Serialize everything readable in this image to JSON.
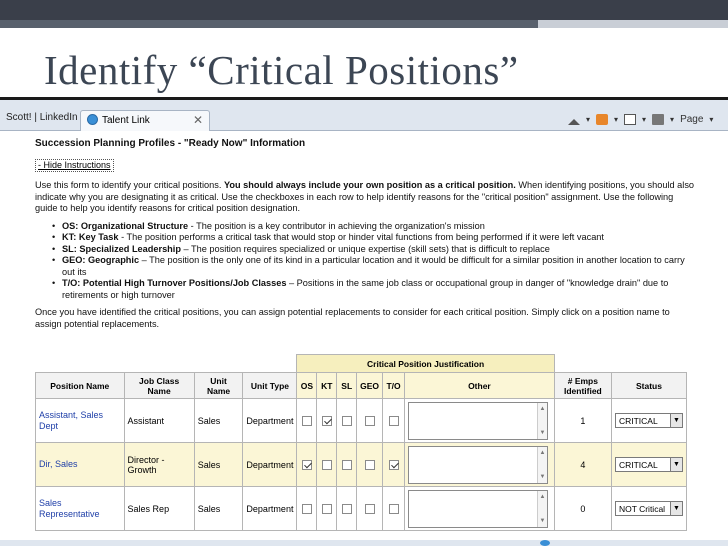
{
  "slide": {
    "title": "Identify “Critical Positions”"
  },
  "browser": {
    "tab_first": "Scott! | LinkedIn",
    "tab_active": "Talent Link",
    "tab_close": "✕",
    "page_menu": "Page"
  },
  "content": {
    "heading": "Succession Planning Profiles - \"Ready Now\" Information",
    "hide_link": "- Hide Instructions",
    "intro_1": "Use this form to identify your critical positions. ",
    "intro_bold": "You should always include your own position as a critical position.",
    "intro_2": " When identifying positions, you should also indicate why you are designating it as critical. Use the checkboxes in each row to help identify reasons for the \"critical position\" assignment. Use the following guide to help you identify reasons for critical position designation.",
    "bullets": [
      {
        "term": "OS: Organizational Structure",
        "desc": " - The position is a key contributor in achieving the organization's mission"
      },
      {
        "term": "KT: Key Task",
        "desc": " - The position performs a critical task that would stop or hinder vital functions from being performed if it were left vacant"
      },
      {
        "term": "SL: Specialized Leadership",
        "desc": " – The position requires specialized or unique expertise (skill sets) that is difficult to replace"
      },
      {
        "term": "GEO: Geographic",
        "desc": " – The position is the only one of its kind in a particular location and it would be difficult for a similar position in another location to carry out its"
      },
      {
        "term": "T/O: Potential High Turnover Positions/Job Classes",
        "desc": " – Positions in the same job class or occupational group in danger of \"knowledge drain\" due to retirements or high turnover"
      }
    ],
    "after": "Once you have identified the critical positions, you can assign potential replacements to consider for each critical position. Simply click on a position name to assign potential replacements."
  },
  "table": {
    "group_header": "Critical Position Justification",
    "headers": {
      "position": "Position Name",
      "job_class": "Job Class Name",
      "unit": "Unit Name",
      "unit_type": "Unit Type",
      "os": "OS",
      "kt": "KT",
      "sl": "SL",
      "geo": "GEO",
      "to": "T/O",
      "other": "Other",
      "emps": "# Emps Identified",
      "status": "Status"
    },
    "rows": [
      {
        "position": "Assistant, Sales Dept",
        "job_class": "Assistant",
        "unit": "Sales",
        "unit_type": "Department",
        "os": false,
        "kt": true,
        "sl": false,
        "geo": false,
        "to": false,
        "other": "",
        "emps": "1",
        "status": "CRITICAL"
      },
      {
        "position": "Dir, Sales",
        "job_class": "Director - Growth",
        "unit": "Sales",
        "unit_type": "Department",
        "os": true,
        "kt": false,
        "sl": false,
        "geo": false,
        "to": true,
        "other": "",
        "emps": "4",
        "status": "CRITICAL"
      },
      {
        "position": "Sales Representative",
        "job_class": "Sales Rep",
        "unit": "Sales",
        "unit_type": "Department",
        "os": false,
        "kt": false,
        "sl": false,
        "geo": false,
        "to": false,
        "other": "",
        "emps": "0",
        "status": "NOT Critical"
      }
    ]
  }
}
